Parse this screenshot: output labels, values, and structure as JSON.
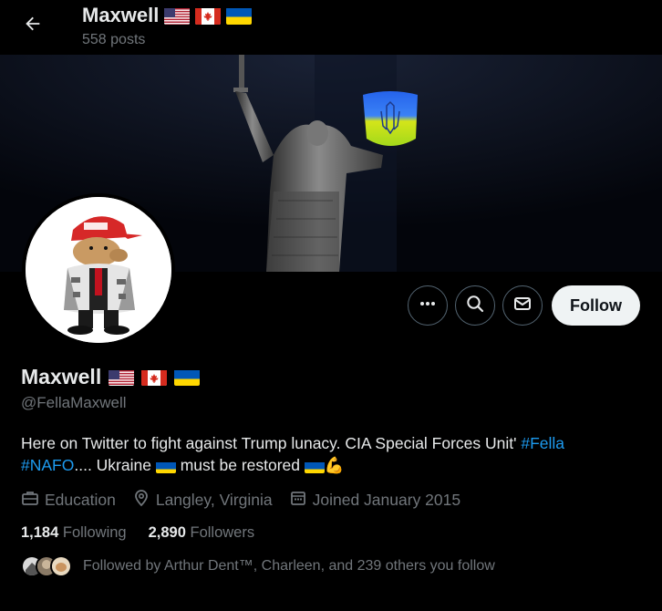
{
  "header": {
    "name": "Maxwell",
    "posts": "558 posts"
  },
  "flags": [
    "us-flag-icon",
    "canada-flag-icon",
    "ukraine-flag-icon"
  ],
  "profile": {
    "name": "Maxwell",
    "handle": "@FellaMaxwell",
    "bio": {
      "text_1": "Here on Twitter to fight against Trump lunacy. CIA Special Forces Unit' ",
      "tag_1": "#Fella",
      "tag_2": "#NAFO",
      "text_2": ".... Ukraine ",
      "text_3": " must be restored ",
      "emoji_flexed": "💪"
    },
    "category": "Education",
    "location": "Langley, Virginia",
    "joined": "Joined January 2015"
  },
  "actions": {
    "follow_label": "Follow"
  },
  "stats": {
    "following_count": "1,184",
    "following_label": "Following",
    "followers_count": "2,890",
    "followers_label": "Followers"
  },
  "followed_by": "Followed by Arthur Dent™, Charleen, and 239 others you follow",
  "colors": {
    "accent": "#1d9bf0",
    "muted": "#71767b",
    "text": "#e7e9ea",
    "ukraine_blue": "#0057b7",
    "ukraine_yellow": "#ffd700"
  }
}
